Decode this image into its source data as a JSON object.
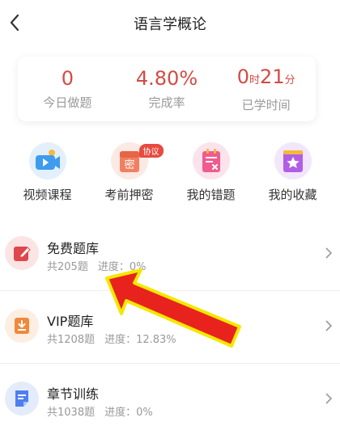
{
  "header": {
    "title": "语言学概论"
  },
  "stats": [
    {
      "value": "0",
      "label": "今日做题"
    },
    {
      "value": "4.80%",
      "label": "完成率"
    },
    {
      "hours": "0",
      "hours_unit": "时",
      "minutes": "21",
      "minutes_unit": "分",
      "label": "已学时间"
    }
  ],
  "shortcuts": [
    {
      "label": "视频课程",
      "icon": "video-icon"
    },
    {
      "label": "考前押密",
      "icon": "secret-icon",
      "badge": "协议",
      "icon_text": "密"
    },
    {
      "label": "我的错题",
      "icon": "wrong-questions-icon"
    },
    {
      "label": "我的收藏",
      "icon": "star-icon"
    }
  ],
  "list": [
    {
      "title": "免费题库",
      "count": "共205题",
      "progress": "进度：0%",
      "icon": "edit-icon"
    },
    {
      "title": "VIP题库",
      "count": "共1208题",
      "progress": "进度：12.83%",
      "icon": "download-icon"
    },
    {
      "title": "章节训练",
      "count": "共1038题",
      "progress": "进度：0%",
      "icon": "document-icon"
    }
  ],
  "colors": {
    "accent": "#d34b44",
    "annotation_arrow": "#e8231e",
    "annotation_outline": "#f5e800"
  }
}
